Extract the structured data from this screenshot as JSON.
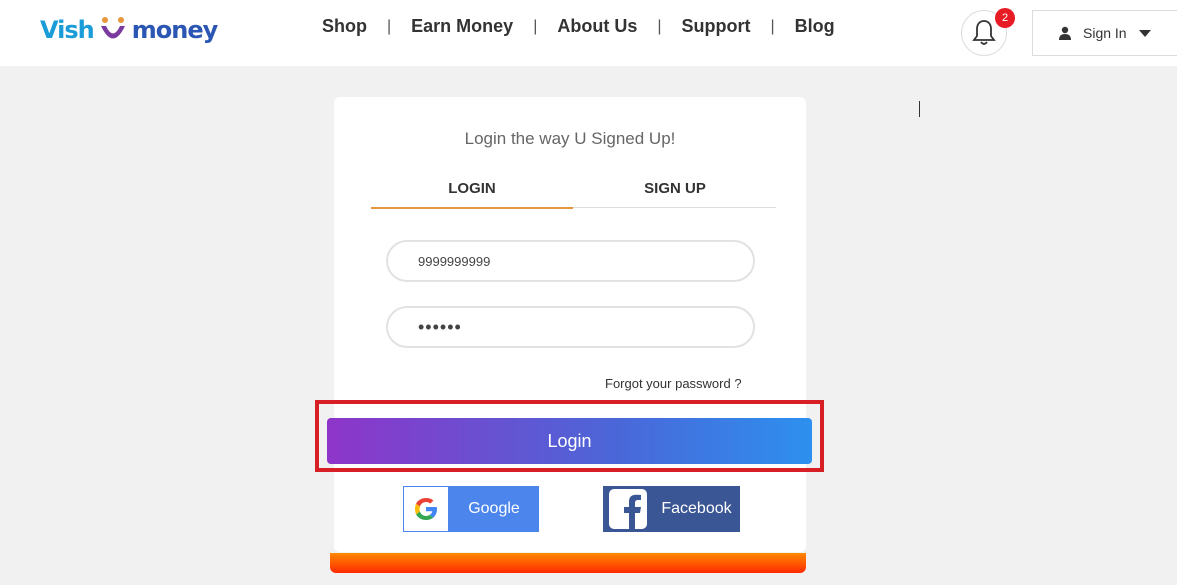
{
  "header": {
    "logo": {
      "part1": "Vish",
      "part2": "money"
    },
    "nav": [
      "Shop",
      "Earn Money",
      "About Us",
      "Support",
      "Blog"
    ],
    "separator": "|",
    "notifications": {
      "count": "2"
    },
    "signin": {
      "label": "Sign In"
    }
  },
  "login_card": {
    "subtitle": "Login the way U Signed Up!",
    "tabs": [
      {
        "label": "LOGIN",
        "active": true
      },
      {
        "label": "SIGN UP",
        "active": false
      }
    ],
    "phone_value": "9999999999",
    "password_value": "••••••",
    "forgot_label": "Forgot your password ?",
    "login_label": "Login",
    "google_label": "Google",
    "facebook_label": "Facebook"
  },
  "colors": {
    "accent": "#e8963d",
    "login_gradient_start": "#8e35c9",
    "login_gradient_end": "#2d90ef",
    "google": "#4c86ec",
    "facebook": "#3b5694",
    "highlight": "#d62026",
    "badge": "#e81c24"
  }
}
